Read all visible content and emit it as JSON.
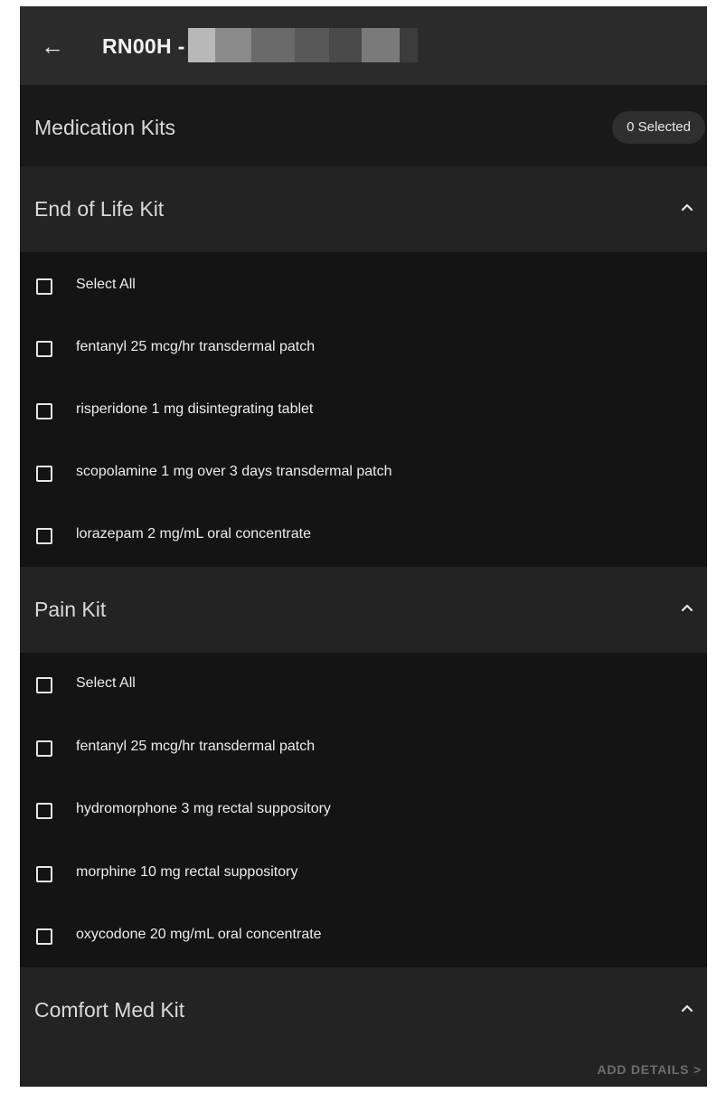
{
  "header": {
    "title": "RN00H -",
    "back_icon": "arrow-left-icon"
  },
  "kits_header": {
    "title": "Medication Kits",
    "selected_badge": "0 Selected"
  },
  "sections": [
    {
      "title": "End of Life Kit",
      "expanded": true,
      "select_all": "Select All",
      "items": [
        "fentanyl 25 mcg/hr transdermal patch",
        "risperidone 1 mg disintegrating tablet",
        "scopolamine 1 mg over 3 days transdermal patch",
        "lorazepam 2 mg/mL oral concentrate"
      ]
    },
    {
      "title": "Pain Kit",
      "expanded": true,
      "select_all": "Select All",
      "items": [
        "fentanyl 25 mcg/hr transdermal patch",
        "hydromorphone 3 mg rectal suppository",
        "morphine 10 mg rectal suppository",
        "oxycodone 20 mg/mL oral concentrate"
      ]
    },
    {
      "title": "Comfort Med Kit",
      "expanded": true
    }
  ],
  "footer": {
    "action": "ADD DETAILS  >"
  },
  "colors": {
    "background": "#141414",
    "topbar": "#2b2b2b",
    "section_header": "#232323",
    "text": "#e6e6e6"
  }
}
